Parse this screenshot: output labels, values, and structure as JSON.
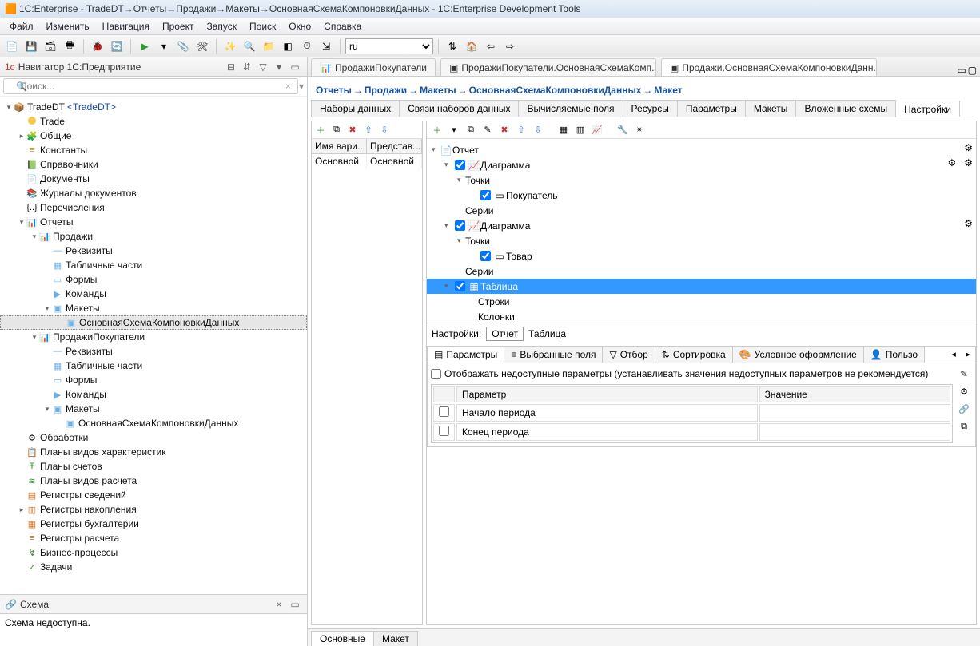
{
  "title": "1C:Enterprise - TradeDT→Отчеты→Продажи→Макеты→ОсновнаяСхемаКомпоновкиДанных - 1C:Enterprise Development Tools",
  "menu": [
    "Файл",
    "Изменить",
    "Навигация",
    "Проект",
    "Запуск",
    "Поиск",
    "Окно",
    "Справка"
  ],
  "toolbar": {
    "lang": "ru"
  },
  "nav": {
    "title": "Навигатор 1С:Предприятие",
    "search_placeholder": "Поиск...",
    "root": "TradeDT",
    "root_hint": "<TradeDT>",
    "items": {
      "trade": "Trade",
      "common": "Общие",
      "constants": "Константы",
      "refs": "Справочники",
      "docs": "Документы",
      "journals": "Журналы документов",
      "enums": "Перечисления",
      "reports": "Отчеты",
      "sales": "Продажи",
      "requisites": "Реквизиты",
      "tabparts": "Табличные части",
      "forms": "Формы",
      "commands": "Команды",
      "layouts": "Макеты",
      "main_schema": "ОсновнаяСхемаКомпоновкиДанных",
      "sales_buyers": "ПродажиПокупатели",
      "processors": "Обработки",
      "pvc": "Планы видов характеристик",
      "accounts": "Планы счетов",
      "calc_plans": "Планы видов расчета",
      "info_reg": "Регистры сведений",
      "accum_reg": "Регистры накопления",
      "acct_reg": "Регистры бухгалтерии",
      "calc_reg": "Регистры расчета",
      "bp": "Бизнес-процессы",
      "tasks": "Задачи"
    }
  },
  "schema_panel": {
    "title": "Схема",
    "text": "Схема недоступна."
  },
  "editor_tabs": {
    "t1": "ПродажиПокупатели",
    "t2": "ПродажиПокупатели.ОсновнаяСхемаКомп...",
    "t3": "Продажи.ОсновнаяСхемаКомпоновкиДанн..."
  },
  "breadcrumb": [
    "Отчеты",
    "Продажи",
    "Макеты",
    "ОсновнаяСхемаКомпоновкиДанных",
    "Макет"
  ],
  "subtabs": [
    "Наборы данных",
    "Связи наборов данных",
    "Вычисляемые поля",
    "Ресурсы",
    "Параметры",
    "Макеты",
    "Вложенные схемы",
    "Настройки"
  ],
  "variants": {
    "h1": "Имя вари..",
    "h2": "Представ...",
    "r1c1": "Основной",
    "r1c2": "Основной"
  },
  "structure": {
    "report": "Отчет",
    "diagram": "Диаграмма",
    "points": "Точки",
    "buyer": "Покупатель",
    "series": "Серии",
    "product": "Товар",
    "table": "Таблица",
    "rows": "Строки",
    "cols": "Колонки"
  },
  "settings_row": {
    "label": "Настройки:",
    "chip": "Отчет",
    "trail": "Таблица"
  },
  "param_tabs": [
    "Параметры",
    "Выбранные поля",
    "Отбор",
    "Сортировка",
    "Условное оформление",
    "Пользо"
  ],
  "params": {
    "show_unavailable": "Отображать недоступные параметры (устанавливать значения недоступных параметров не рекомендуется)",
    "col_param": "Параметр",
    "col_val": "Значение",
    "p1": "Начало периода",
    "p2": "Конец периода"
  },
  "bottom_tabs": [
    "Основные",
    "Макет"
  ]
}
